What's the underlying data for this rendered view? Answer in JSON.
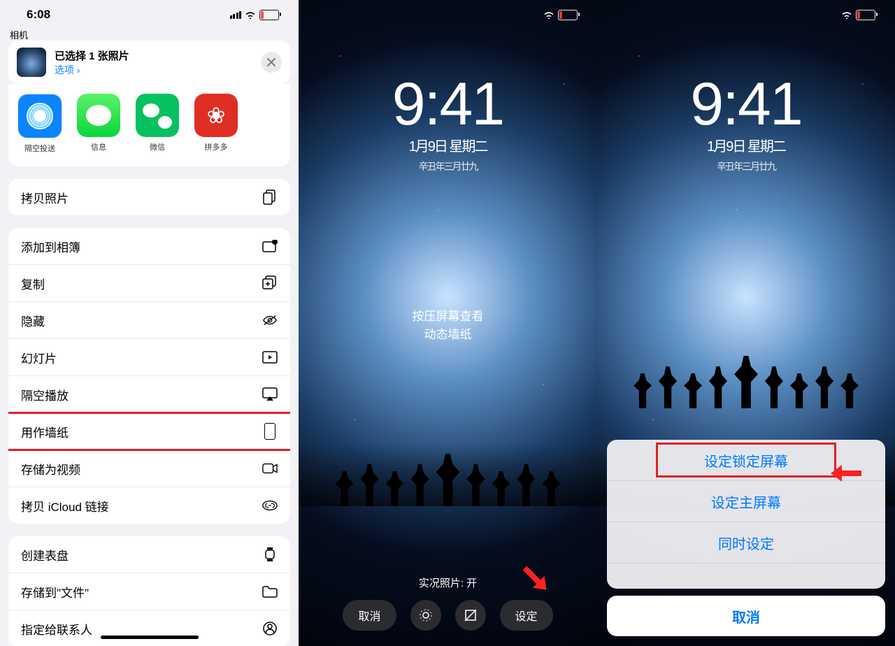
{
  "panel1": {
    "statusTime": "6:08",
    "backLabel": "相机",
    "header": {
      "title": "已选择 1 张照片",
      "optionsLabel": "选项 ›"
    },
    "apps": [
      {
        "label": "隔空投送",
        "cls": "ai-airdrop"
      },
      {
        "label": "信息",
        "cls": "ai-msg"
      },
      {
        "label": "微信",
        "cls": "ai-wx"
      },
      {
        "label": "拼多多",
        "cls": "ai-pdd"
      }
    ],
    "group1": [
      {
        "label": "拷贝照片",
        "icon": "copies-icon"
      }
    ],
    "group2": [
      {
        "label": "添加到相簿",
        "icon": "album-icon"
      },
      {
        "label": "复制",
        "icon": "copy-plus-icon"
      },
      {
        "label": "隐藏",
        "icon": "hide-icon"
      },
      {
        "label": "幻灯片",
        "icon": "slideshow-icon"
      },
      {
        "label": "隔空播放",
        "icon": "airplay-icon"
      },
      {
        "label": "用作墙纸",
        "icon": "phone-icon",
        "highlight": true
      },
      {
        "label": "存储为视频",
        "icon": "video-icon"
      },
      {
        "label": "拷贝 iCloud 链接",
        "icon": "link-icon"
      }
    ],
    "group3": [
      {
        "label": "创建表盘",
        "icon": "watch-icon"
      },
      {
        "label": "存储到\"文件\"",
        "icon": "folder-icon"
      },
      {
        "label": "指定给联系人",
        "icon": "contact-icon"
      }
    ]
  },
  "lock": {
    "time": "9:41",
    "date": "1月9日 星期二",
    "lunar": "辛丑年三月廿九",
    "pressLine1": "按压屏幕查看",
    "pressLine2": "动态墙纸",
    "liveLabel": "实况照片: 开",
    "cancelBtn": "取消",
    "setBtn": "设定"
  },
  "sheet": {
    "rows": [
      {
        "label": "设定锁定屏幕",
        "highlight": true
      },
      {
        "label": "设定主屏幕"
      },
      {
        "label": "同时设定"
      }
    ],
    "cancel": "取消"
  }
}
